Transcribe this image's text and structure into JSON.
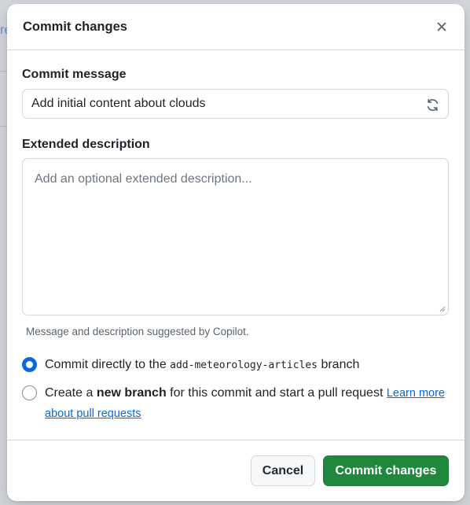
{
  "background": {
    "partial_link_text": "re"
  },
  "modal": {
    "title": "Commit changes",
    "close_icon": "x-icon"
  },
  "commit_message": {
    "label": "Commit message",
    "value": "Add initial content about clouds",
    "regenerate_icon": "sync-icon"
  },
  "extended_description": {
    "label": "Extended description",
    "value": "",
    "placeholder": "Add an optional extended description..."
  },
  "copilot_note": "Message and description suggested by Copilot.",
  "branch_options": {
    "direct": {
      "selected": true,
      "text_before": "Commit directly to the ",
      "branch_name": "add-meteorology-articles",
      "text_after": " branch"
    },
    "new_branch": {
      "selected": false,
      "text_before": "Create a ",
      "bold_text": "new branch",
      "text_after": " for this commit and start a pull request ",
      "link_text": "Learn more about pull requests"
    }
  },
  "footer": {
    "cancel_label": "Cancel",
    "commit_label": "Commit changes"
  },
  "colors": {
    "primary_button": "#1f883d",
    "accent_blue": "#0969da",
    "border": "#d1d9e0",
    "muted_text": "#59636e"
  }
}
